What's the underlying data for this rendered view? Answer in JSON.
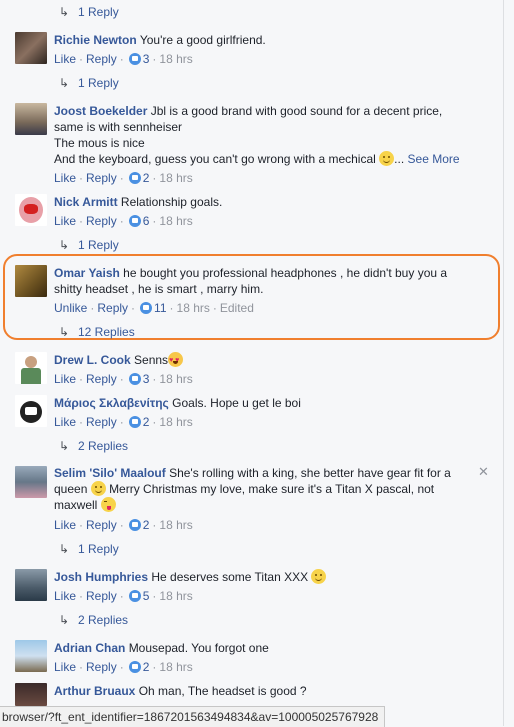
{
  "actions": {
    "like": "Like",
    "unlike": "Unlike",
    "reply": "Reply",
    "sep": "·",
    "see_more": "See More",
    "ellipsis": "...",
    "edited": "Edited"
  },
  "top_reply_link": "1 Reply",
  "comments": [
    {
      "author": "Richie Newton",
      "text": "You're a good girlfriend.",
      "likes": "3",
      "time": "18 hrs",
      "replies": "1 Reply"
    },
    {
      "author": "Joost Boekelder",
      "text_lines": [
        "Jbl is a good brand with good sound for a decent price,",
        "same is with sennheiser",
        "The mous is nice",
        "And the keyboard, guess you can't go wrong with a mechical"
      ],
      "likes": "2",
      "time": "18 hrs"
    },
    {
      "author": "Nick Armitt",
      "text": "Relationship goals.",
      "likes": "6",
      "time": "18 hrs",
      "replies": "1 Reply"
    },
    {
      "author": "Omar Yaish",
      "text_line1": "he bought you professional headphones , he didn't buy you a",
      "text_line2": "shitty headset , he is smart , marry him.",
      "likes": "11",
      "time": "18 hrs",
      "replies": "12 Replies"
    },
    {
      "author": "Drew L. Cook",
      "text": "Senns",
      "likes": "3",
      "time": "18 hrs"
    },
    {
      "author": "Μάριος Σκλαβενίτης",
      "text": "Goals. Hope u get le boi",
      "likes": "2",
      "time": "18 hrs",
      "replies": "2 Replies"
    },
    {
      "author": "Selim 'Silo' Maalouf",
      "text_line1": "She's rolling with a king, she better have gear fit for a",
      "text_line2a": "queen",
      "text_line2b": "Merry Christmas my love, make sure it's a Titan X pascal, not",
      "text_line3": "maxwell",
      "likes": "2",
      "time": "18 hrs",
      "replies": "1 Reply"
    },
    {
      "author": "Josh Humphries",
      "text": "He deserves some Titan XXX",
      "likes": "5",
      "time": "18 hrs",
      "replies": "2 Replies"
    },
    {
      "author": "Adrian Chan",
      "text": "Mousepad. You forgot one",
      "likes": "2",
      "time": "18 hrs"
    },
    {
      "author": "Arthur Bruaux",
      "text": "Oh man, The headset is good ?"
    }
  ],
  "close_glyph": "✕",
  "status_url": "browser/?ft_ent_identifier=1867201563494834&av=100005025767928",
  "colors": {
    "link": "#365899",
    "meta": "#90949c",
    "highlight": "#f07f2e",
    "like": "#4a90e2"
  }
}
